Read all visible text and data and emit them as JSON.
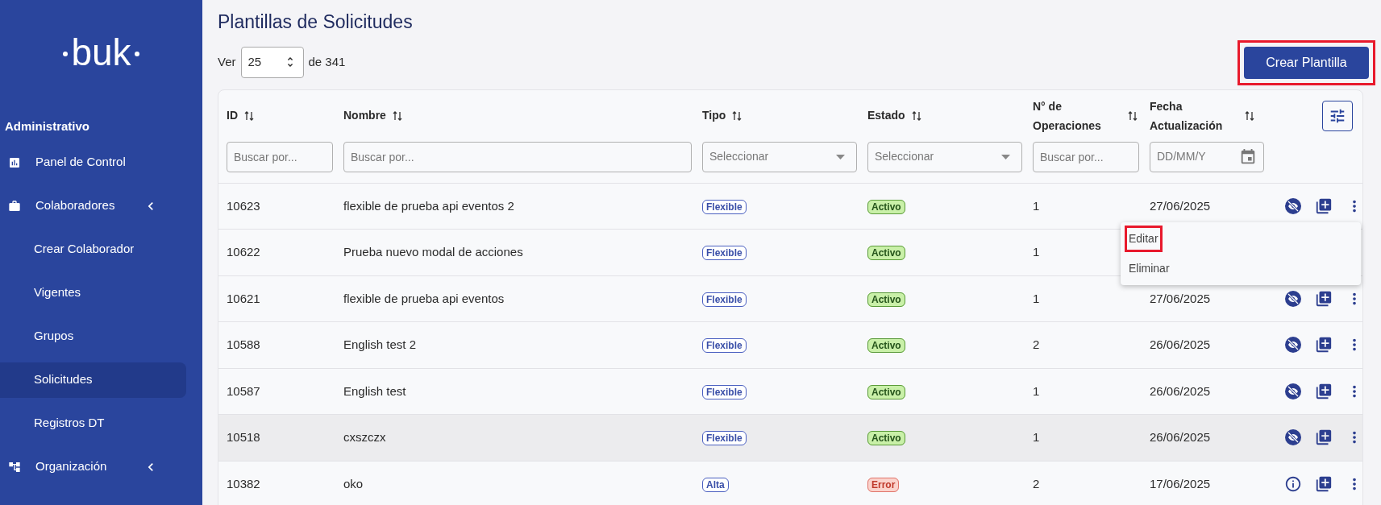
{
  "sidebar": {
    "logo": "buk",
    "section": "Administrativo",
    "items": [
      {
        "label": "Panel de Control",
        "selected": false
      },
      {
        "label": "Colaboradores",
        "selected": false,
        "children": [
          {
            "label": "Crear Colaborador",
            "selected": false
          },
          {
            "label": "Vigentes",
            "selected": false
          },
          {
            "label": "Grupos",
            "selected": false
          },
          {
            "label": "Solicitudes",
            "selected": true
          },
          {
            "label": "Registros DT",
            "selected": false
          }
        ]
      },
      {
        "label": "Organización",
        "selected": false
      }
    ]
  },
  "page": {
    "title": "Plantillas de Solicitudes",
    "page_size": {
      "prefix": "Ver",
      "value": "25",
      "suffix": "de 341"
    },
    "create_button": {
      "label": "Crear Plantilla",
      "highlighted": true
    }
  },
  "table": {
    "columns": [
      {
        "label": "ID",
        "filter": {
          "kind": "text",
          "placeholder": "Buscar por..."
        }
      },
      {
        "label": "Nombre",
        "filter": {
          "kind": "text",
          "placeholder": "Buscar por..."
        }
      },
      {
        "label": "Tipo",
        "filter": {
          "kind": "select",
          "placeholder": "Seleccionar"
        }
      },
      {
        "label": "Estado",
        "filter": {
          "kind": "select",
          "placeholder": "Seleccionar"
        }
      },
      {
        "label": "N° de Operaciones",
        "filter": {
          "kind": "text",
          "placeholder": "Buscar por..."
        }
      },
      {
        "label": "Fecha Actualización",
        "filter": {
          "kind": "date",
          "placeholder": "DD/MM/Y"
        }
      }
    ],
    "rows": [
      {
        "id": "10623",
        "name": "flexible de prueba api eventos 2",
        "type": "Flexible",
        "status": {
          "label": "Activo",
          "kind": "active"
        },
        "operations": "1",
        "date": "27/06/2025",
        "highlighted": false
      },
      {
        "id": "10622",
        "name": "Prueba nuevo modal de acciones",
        "type": "Flexible",
        "status": {
          "label": "Activo",
          "kind": "active"
        },
        "operations": "1",
        "highlighted": false
      },
      {
        "id": "10621",
        "name": "flexible de prueba api eventos",
        "type": "Flexible",
        "status": {
          "label": "Activo",
          "kind": "active"
        },
        "operations": "1",
        "date": "27/06/2025",
        "highlighted": false
      },
      {
        "id": "10588",
        "name": "English test 2",
        "type": "Flexible",
        "status": {
          "label": "Activo",
          "kind": "active"
        },
        "operations": "2",
        "date": "26/06/2025",
        "highlighted": false
      },
      {
        "id": "10587",
        "name": "English test",
        "type": "Flexible",
        "status": {
          "label": "Activo",
          "kind": "active"
        },
        "operations": "1",
        "date": "26/06/2025",
        "highlighted": false
      },
      {
        "id": "10518",
        "name": "cxszczx",
        "type": "Flexible",
        "status": {
          "label": "Activo",
          "kind": "active"
        },
        "operations": "1",
        "date": "26/06/2025",
        "highlighted": true
      },
      {
        "id": "10382",
        "name": "oko",
        "type": "Alta",
        "status": {
          "label": "Error",
          "kind": "error"
        },
        "operations": "2",
        "date": "17/06/2025",
        "highlighted": false
      }
    ]
  },
  "row_menu": {
    "items": [
      {
        "label": "Editar",
        "highlighted": true
      },
      {
        "label": "Eliminar",
        "highlighted": false
      }
    ]
  }
}
